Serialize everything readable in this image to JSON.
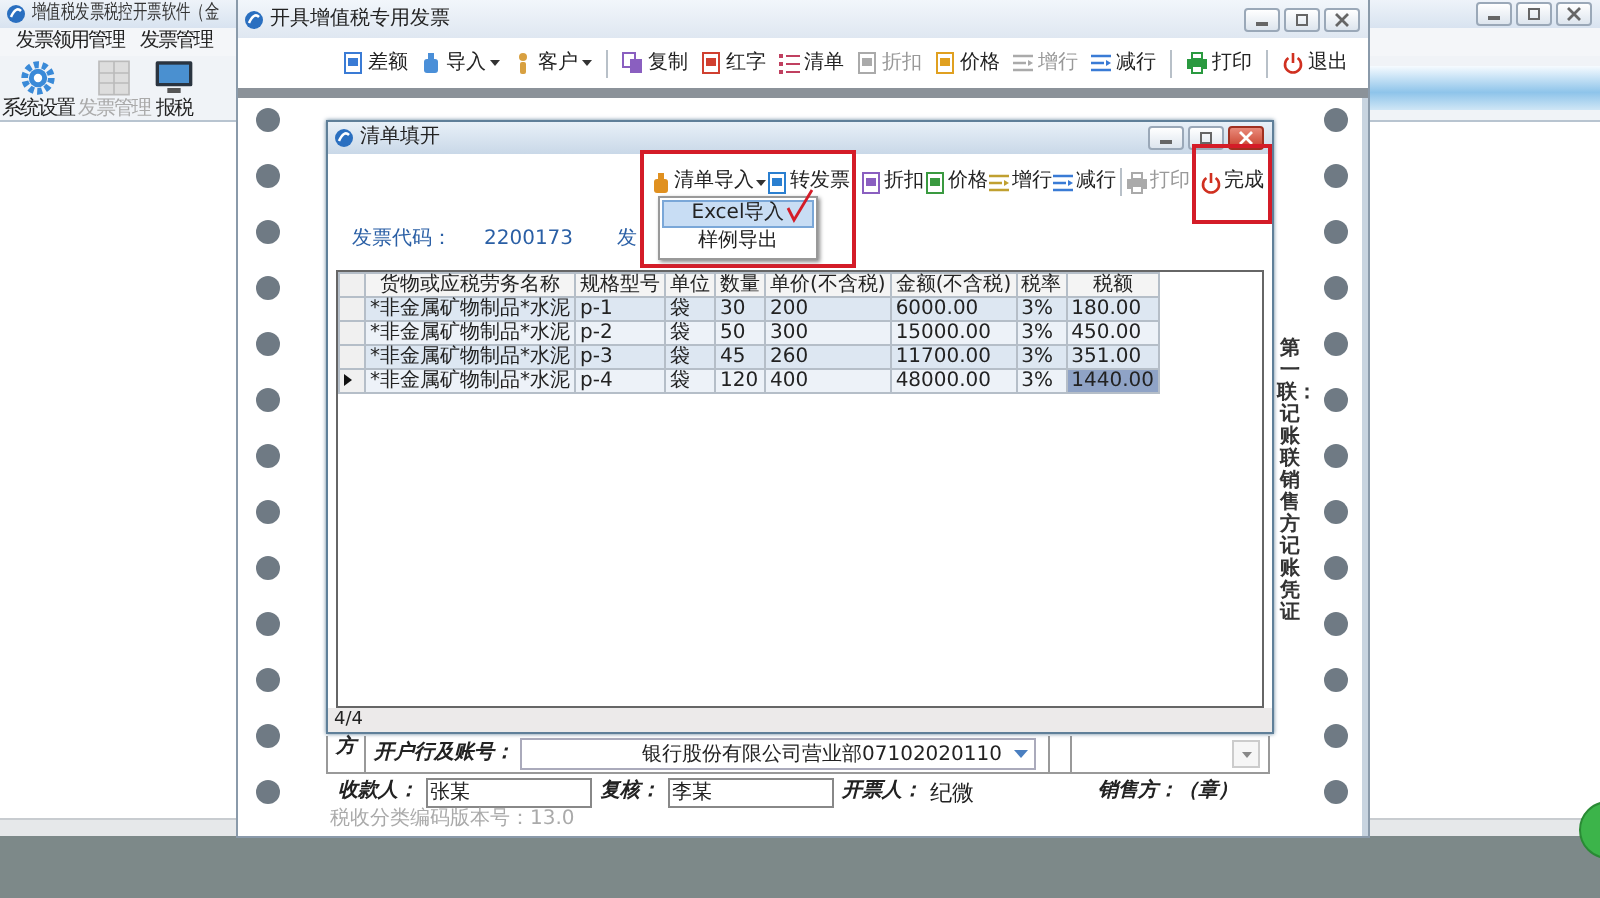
{
  "main_window": {
    "title": "增值税发票税控开票软件（金",
    "menu": [
      "发票领用管理",
      "发票管理"
    ],
    "toolbar": [
      {
        "label": "系统设置",
        "disabled": false
      },
      {
        "label": "发票管理",
        "disabled": true
      },
      {
        "label": "报税",
        "disabled": false
      }
    ]
  },
  "invoice_window": {
    "title": "开具增值税专用发票",
    "toolbar": [
      {
        "label": "差额",
        "disabled": false,
        "dropdown": false,
        "separator_before": false
      },
      {
        "label": "导入",
        "disabled": false,
        "dropdown": true,
        "separator_before": false
      },
      {
        "label": "客户",
        "disabled": false,
        "dropdown": true,
        "separator_before": false
      },
      {
        "label": "复制",
        "disabled": false,
        "dropdown": false,
        "separator_before": true
      },
      {
        "label": "红字",
        "disabled": false,
        "dropdown": false,
        "separator_before": false
      },
      {
        "label": "清单",
        "disabled": false,
        "dropdown": false,
        "separator_before": false
      },
      {
        "label": "折扣",
        "disabled": true,
        "dropdown": false,
        "separator_before": false
      },
      {
        "label": "价格",
        "disabled": false,
        "dropdown": false,
        "separator_before": false
      },
      {
        "label": "增行",
        "disabled": true,
        "dropdown": false,
        "separator_before": false
      },
      {
        "label": "减行",
        "disabled": false,
        "dropdown": false,
        "separator_before": false
      },
      {
        "label": "打印",
        "disabled": false,
        "dropdown": false,
        "separator_before": true
      },
      {
        "label": "退出",
        "disabled": false,
        "dropdown": false,
        "separator_before": true
      }
    ],
    "seller_side": "方",
    "bank_account": {
      "label": "开户行及账号：",
      "value": "银行股份有限公司营业部07102020110"
    },
    "signatures": [
      {
        "kind": "field",
        "label": "收款人：",
        "value": "张某"
      },
      {
        "kind": "field",
        "label": "复核：",
        "value": "李某"
      },
      {
        "kind": "text",
        "label": "开票人：",
        "value": "纪微"
      }
    ],
    "seller_seal": "销售方：（章）",
    "version": "税收分类编码版本号：13.0",
    "copy_note": "第一联：记账联销售方记账凭证"
  },
  "dialog": {
    "title": "清单填开",
    "toolbar": [
      {
        "label": "清单导入",
        "disabled": false,
        "dropdown": true,
        "separator_before": false
      },
      {
        "label": "转发票",
        "disabled": false,
        "dropdown": false,
        "separator_before": false
      },
      {
        "label": "折扣",
        "disabled": false,
        "dropdown": false,
        "separator_before": true
      },
      {
        "label": "价格",
        "disabled": false,
        "dropdown": false,
        "separator_before": false
      },
      {
        "label": "增行",
        "disabled": false,
        "dropdown": false,
        "separator_before": false
      },
      {
        "label": "减行",
        "disabled": false,
        "dropdown": false,
        "separator_before": false
      },
      {
        "label": "打印",
        "disabled": true,
        "dropdown": false,
        "separator_before": true
      },
      {
        "label": "完成",
        "disabled": false,
        "dropdown": false,
        "separator_before": false
      }
    ],
    "menu": [
      {
        "label": "Excel导入",
        "selected": true
      },
      {
        "label": "样例导出",
        "selected": false
      }
    ],
    "invoice_code": {
      "label": "发票代码：",
      "value": "2200173"
    },
    "cut_label": "发",
    "table": {
      "columns": [
        "货物或应税劳务名称",
        "规格型号",
        "单位",
        "数量",
        "单价(不含税)",
        "金额(不含税)",
        "税率",
        "税额"
      ],
      "rows": [
        {
          "current": false,
          "cells": [
            {
              "text": "*非金属矿物制品*水泥",
              "selected": false
            },
            {
              "text": "p-1",
              "selected": false
            },
            {
              "text": "袋",
              "selected": false
            },
            {
              "text": "30",
              "selected": false
            },
            {
              "text": "200",
              "selected": false
            },
            {
              "text": "6000.00",
              "selected": false
            },
            {
              "text": "3%",
              "selected": false
            },
            {
              "text": "180.00",
              "selected": false
            }
          ]
        },
        {
          "current": false,
          "cells": [
            {
              "text": "*非金属矿物制品*水泥",
              "selected": false
            },
            {
              "text": "p-2",
              "selected": false
            },
            {
              "text": "袋",
              "selected": false
            },
            {
              "text": "50",
              "selected": false
            },
            {
              "text": "300",
              "selected": false
            },
            {
              "text": "15000.00",
              "selected": false
            },
            {
              "text": "3%",
              "selected": false
            },
            {
              "text": "450.00",
              "selected": false
            }
          ]
        },
        {
          "current": false,
          "cells": [
            {
              "text": "*非金属矿物制品*水泥",
              "selected": false
            },
            {
              "text": "p-3",
              "selected": false
            },
            {
              "text": "袋",
              "selected": false
            },
            {
              "text": "45",
              "selected": false
            },
            {
              "text": "260",
              "selected": false
            },
            {
              "text": "11700.00",
              "selected": false
            },
            {
              "text": "3%",
              "selected": false
            },
            {
              "text": "351.00",
              "selected": false
            }
          ]
        },
        {
          "current": true,
          "cells": [
            {
              "text": "*非金属矿物制品*水泥",
              "selected": false
            },
            {
              "text": "p-4",
              "selected": false
            },
            {
              "text": "袋",
              "selected": false
            },
            {
              "text": "120",
              "selected": false
            },
            {
              "text": "400",
              "selected": false
            },
            {
              "text": "48000.00",
              "selected": false
            },
            {
              "text": "3%",
              "selected": false
            },
            {
              "text": "1440.00",
              "selected": true
            }
          ]
        }
      ]
    },
    "status": "4/4"
  }
}
